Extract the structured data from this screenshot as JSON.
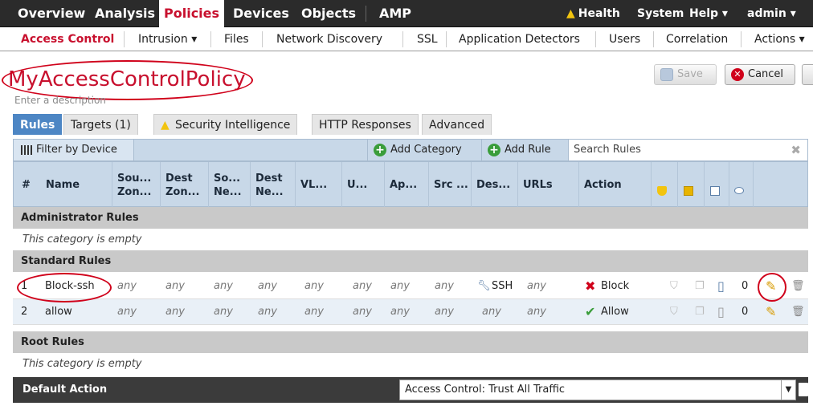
{
  "topnav": {
    "items": [
      "Overview",
      "Analysis",
      "Policies",
      "Devices",
      "Objects",
      "AMP"
    ],
    "health": "Health",
    "system": "System",
    "help": "Help ▾",
    "user": "admin ▾"
  },
  "subnav": {
    "items": [
      "Access Control",
      "Intrusion ▾",
      "Files",
      "Network Discovery",
      "SSL",
      "Application Detectors",
      "Users",
      "Correlation",
      "Actions ▾"
    ]
  },
  "policy": {
    "name": "MyAccessControlPolicy",
    "description_placeholder": "Enter a description"
  },
  "buttons": {
    "save": "Save",
    "cancel": "Cancel"
  },
  "tabs": [
    "Rules",
    "Targets (1)",
    "Security Intelligence",
    "HTTP Responses",
    "Advanced"
  ],
  "toolbar": {
    "filter": "Filter by Device",
    "add_category": "Add Category",
    "add_rule": "Add Rule",
    "search_placeholder": "Search Rules"
  },
  "columns": {
    "num": "#",
    "name": "Name",
    "src_zone": "Sou... Zon...",
    "dest_zone": "Dest Zon...",
    "src_net": "So... Ne...",
    "dest_net": "Dest Ne...",
    "vlan": "VL...",
    "users": "U...",
    "apps": "Ap...",
    "src_ports": "Src ...",
    "dest_ports": "Des...",
    "urls": "URLs",
    "action": "Action"
  },
  "categories": {
    "admin": "Administrator Rules",
    "standard": "Standard Rules",
    "root": "Root Rules",
    "empty_text": "This category is empty"
  },
  "rules": [
    {
      "num": "1",
      "name": "Block-ssh",
      "src_zone": "any",
      "dest_zone": "any",
      "src_net": "any",
      "dest_net": "any",
      "vlan": "any",
      "users": "any",
      "apps": "any",
      "src_ports": "any",
      "dest_ports": "SSH",
      "urls": "any",
      "action": "Block",
      "action_color": "#d0021b",
      "count": "0"
    },
    {
      "num": "2",
      "name": "allow",
      "src_zone": "any",
      "dest_zone": "any",
      "src_net": "any",
      "dest_net": "any",
      "vlan": "any",
      "users": "any",
      "apps": "any",
      "src_ports": "any",
      "dest_ports": "any",
      "urls": "any",
      "action": "Allow",
      "action_color": "#3a9d3a",
      "count": "0"
    }
  ],
  "default_action": {
    "label": "Default Action",
    "value": "Access Control: Trust All Traffic"
  },
  "icons": [
    "warning-icon",
    "save-icon",
    "cancel-icon",
    "filter-device-icon",
    "add-icon",
    "clear-search-icon",
    "shield-icon",
    "copy-icon",
    "log-icon",
    "comment-icon",
    "wrench-icon",
    "block-x-icon",
    "allow-check-icon",
    "edit-pencil-icon",
    "delete-icon",
    "dropdown-arrow-icon"
  ]
}
